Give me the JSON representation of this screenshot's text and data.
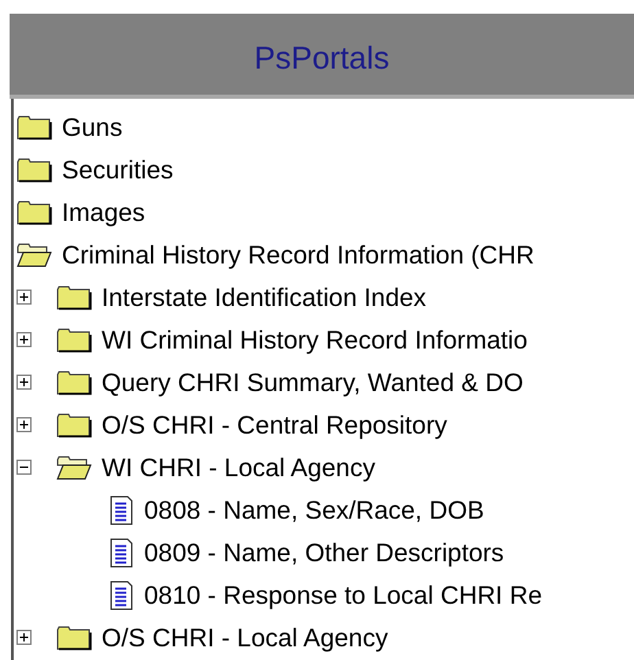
{
  "header": {
    "title": "PsPortals"
  },
  "tree": [
    {
      "kind": "folder",
      "label": "Guns",
      "expanded": false
    },
    {
      "kind": "folder",
      "label": "Securities",
      "expanded": false
    },
    {
      "kind": "folder",
      "label": "Images",
      "expanded": false
    },
    {
      "kind": "folder",
      "label": "Criminal History Record Information (CHR",
      "expanded": true,
      "children": [
        {
          "kind": "folder",
          "label": "Interstate Identification Index",
          "expanded": false
        },
        {
          "kind": "folder",
          "label": "WI Criminal History Record Informatio",
          "expanded": false
        },
        {
          "kind": "folder",
          "label": "Query CHRI Summary, Wanted & DO",
          "expanded": false
        },
        {
          "kind": "folder",
          "label": "O/S CHRI - Central Repository",
          "expanded": false
        },
        {
          "kind": "folder",
          "label": "WI CHRI - Local Agency",
          "expanded": true,
          "children": [
            {
              "kind": "document",
              "label": "0808 - Name, Sex/Race, DOB"
            },
            {
              "kind": "document",
              "label": "0809 - Name, Other Descriptors"
            },
            {
              "kind": "document",
              "label": "0810 - Response to Local CHRI Re"
            }
          ]
        },
        {
          "kind": "folder",
          "label": "O/S CHRI - Local Agency",
          "expanded": false
        }
      ]
    }
  ]
}
